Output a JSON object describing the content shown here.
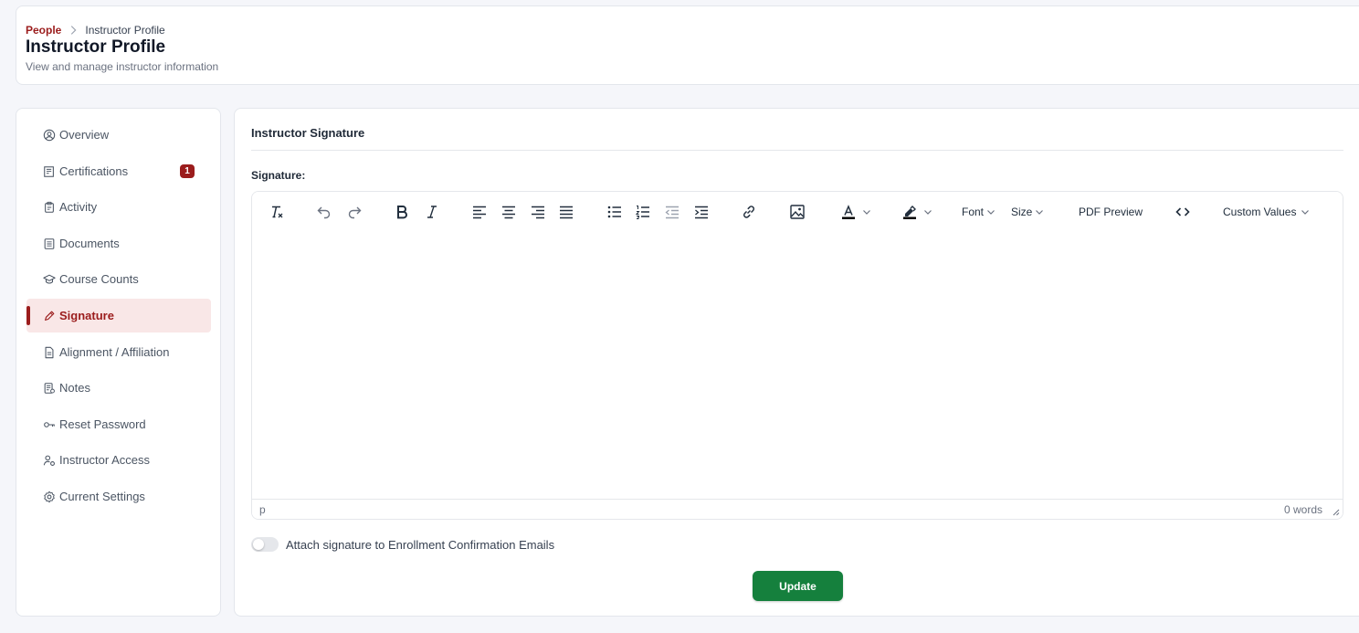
{
  "header": {
    "breadcrumb": {
      "parent": "People",
      "current": "Instructor Profile"
    },
    "title": "Instructor Profile",
    "subtitle": "View and manage instructor information"
  },
  "sidebar": {
    "items": [
      {
        "label": "Overview",
        "icon": "user-circle-icon"
      },
      {
        "label": "Certifications",
        "icon": "certificate-icon",
        "badge": "1"
      },
      {
        "label": "Activity",
        "icon": "clipboard-icon"
      },
      {
        "label": "Documents",
        "icon": "document-icon"
      },
      {
        "label": "Course Counts",
        "icon": "graduation-cap-icon"
      },
      {
        "label": "Signature",
        "icon": "pencil-icon",
        "active": true
      },
      {
        "label": "Alignment / Affiliation",
        "icon": "file-icon"
      },
      {
        "label": "Notes",
        "icon": "notes-icon"
      },
      {
        "label": "Reset Password",
        "icon": "key-icon"
      },
      {
        "label": "Instructor Access",
        "icon": "user-gear-icon"
      },
      {
        "label": "Current Settings",
        "icon": "gear-icon"
      }
    ]
  },
  "main": {
    "section_title": "Instructor Signature",
    "field_label": "Signature:",
    "toolbar": {
      "font_label": "Font",
      "size_label": "Size",
      "pdf_preview_label": "PDF Preview",
      "custom_values_label": "Custom Values"
    },
    "status": {
      "path": "p",
      "word_count": "0 words"
    },
    "toggle": {
      "label": "Attach signature to Enrollment Confirmation Emails",
      "checked": false
    },
    "update_label": "Update"
  },
  "colors": {
    "accent": "#9b1c1c",
    "active_bg": "#f9e7e7",
    "button": "#15803d"
  }
}
